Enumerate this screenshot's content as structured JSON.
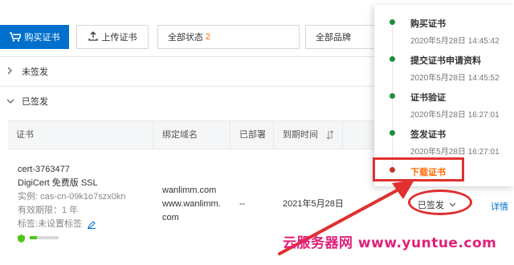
{
  "toolbar": {
    "buy_label": "购买证书",
    "upload_label": "上传证书",
    "status_filter_label": "全部状态",
    "status_filter_count": "2",
    "brand_filter_label": "全部品牌"
  },
  "groups": [
    {
      "label": "未签发",
      "expanded": false
    },
    {
      "label": "已签发",
      "expanded": true
    }
  ],
  "table": {
    "headers": [
      "证书",
      "绑定域名",
      "已部署",
      "到期时间"
    ],
    "rows": [
      {
        "cert_id": "cert-3763477",
        "cert_name": "DigiCert 免费版 SSL",
        "instance": "实例: cas-cn-09k1o7szx0kn",
        "validity": "有效期限：1 年",
        "tags": "标签:未设置标签",
        "domain_line1": "wanlimm.com",
        "domain_line2": "www.wanlimm.",
        "domain_line3": "com",
        "deployed": "--",
        "expiry": "2021年5月28日",
        "status": "已签发",
        "action": "详情"
      }
    ]
  },
  "timeline": [
    {
      "title": "购买证书",
      "time": "2020年5月28日 14:45:42"
    },
    {
      "title": "提交证书申请资料",
      "time": "2020年5月28日 14:45:52"
    },
    {
      "title": "证书验证",
      "time": "2020年5月28日 16:27:01"
    },
    {
      "title": "签发证书",
      "time": "2020年5月28日 16:27:01"
    },
    {
      "title": "下载证书",
      "time": ""
    }
  ],
  "watermark": "云服务器网 www.yuntue.com",
  "colors": {
    "primary": "#0070cc",
    "accent": "#ff6a00",
    "success": "#1e8e3e",
    "annotation": "#e03030",
    "watermark": "#e0207a"
  }
}
